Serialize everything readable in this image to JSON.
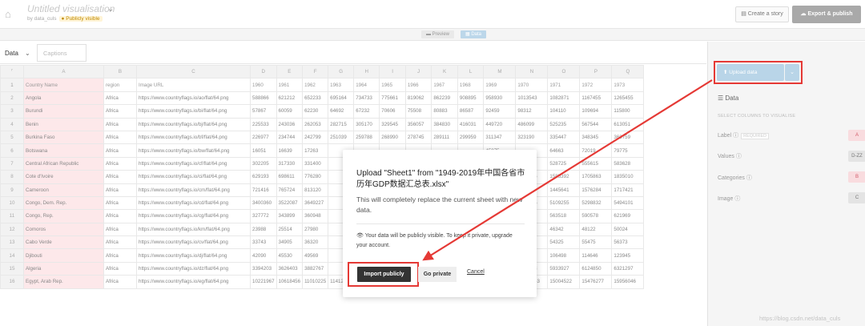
{
  "header": {
    "title": "Untitled visualisation",
    "byline": "by data_culs",
    "visibility_badge": "Publicly visible",
    "create_story": "Create a story",
    "export_publish": "Export & publish"
  },
  "view_toggle": {
    "preview": "Preview",
    "data": "Data"
  },
  "tabs": {
    "data": "Data",
    "captions": "Captions"
  },
  "sheet": {
    "columns": [
      "A",
      "B",
      "C",
      "D",
      "E",
      "F",
      "G",
      "H",
      "I",
      "J",
      "K",
      "L",
      "M",
      "N",
      "O",
      "P",
      "Q"
    ],
    "rows": [
      [
        "Country Name",
        "region",
        "Image URL",
        "1960",
        "1961",
        "1962",
        "1963",
        "1964",
        "1965",
        "1966",
        "1967",
        "1968",
        "1969",
        "1970",
        "1971",
        "1972",
        "1973"
      ],
      [
        "Angola",
        "Africa",
        "https://www.countryflags.io/ao/flat/64.png",
        "588866",
        "621212",
        "652233",
        "695164",
        "734733",
        "775661",
        "819062",
        "862239",
        "908895",
        "958930",
        "1013543",
        "1082871",
        "1167455",
        "1265455"
      ],
      [
        "Burundi",
        "Africa",
        "https://www.countryflags.io/bi/flat/64.png",
        "57867",
        "60059",
        "62230",
        "64692",
        "67232",
        "70606",
        "75508",
        "80883",
        "86587",
        "92459",
        "98312",
        "104110",
        "109694",
        "115800"
      ],
      [
        "Benin",
        "Africa",
        "https://www.countryflags.io/bj/flat/64.png",
        "225533",
        "243036",
        "262053",
        "282715",
        "305170",
        "329545",
        "356057",
        "384830",
        "416031",
        "449720",
        "486099",
        "525235",
        "567544",
        "613051"
      ],
      [
        "Burkina Faso",
        "Africa",
        "https://www.countryflags.io/bf/flat/64.png",
        "226977",
        "234744",
        "242799",
        "251039",
        "259788",
        "268990",
        "278745",
        "289111",
        "299959",
        "311347",
        "323190",
        "335447",
        "348345",
        "363759"
      ],
      [
        "Botswana",
        "Africa",
        "https://www.countryflags.io/bw/flat/64.png",
        "16051",
        "16639",
        "17263",
        "",
        "",
        "",
        "",
        "",
        "",
        "45875",
        "",
        "64663",
        "72019",
        "79775"
      ],
      [
        "Central African Republic",
        "Africa",
        "https://www.countryflags.io/cf/flat/64.png",
        "302205",
        "317330",
        "331400",
        "",
        "",
        "",
        "",
        "",
        "",
        "477093",
        "502249",
        "528725",
        "555615",
        "583628"
      ],
      [
        "Cote d'Ivoire",
        "Africa",
        "https://www.countryflags.io/ci/flat/64.png",
        "629193",
        "698611",
        "776280",
        "",
        "",
        "",
        "",
        "",
        "",
        "1377863",
        "1476416",
        "1585392",
        "1705863",
        "1835010"
      ],
      [
        "Cameroon",
        "Africa",
        "https://www.countryflags.io/cm/flat/64.png",
        "721416",
        "765724",
        "813120",
        "",
        "",
        "",
        "",
        "",
        "",
        "1245992",
        "1325110",
        "1445641",
        "1576284",
        "1717421"
      ],
      [
        "Congo, Dem. Rep.",
        "Africa",
        "https://www.countryflags.io/cd/flat/64.png",
        "3400360",
        "3522087",
        "3649227",
        "",
        "",
        "",
        "",
        "",
        "",
        "4742135",
        "4924045",
        "5109255",
        "5298832",
        "5494101"
      ],
      [
        "Congo, Rep.",
        "Africa",
        "https://www.countryflags.io/cg/flat/64.png",
        "327772",
        "343899",
        "360948",
        "",
        "",
        "",
        "",
        "",
        "",
        "504128",
        "534037",
        "563518",
        "590578",
        "621969"
      ],
      [
        "Comoros",
        "Africa",
        "https://www.countryflags.io/km/flat/64.png",
        "23988",
        "25514",
        "27980",
        "",
        "",
        "",
        "",
        "",
        "",
        "42891",
        "44607",
        "46342",
        "48122",
        "50024"
      ],
      [
        "Cabo Verde",
        "Africa",
        "https://www.countryflags.io/cv/flat/64.png",
        "33743",
        "34905",
        "36320",
        "",
        "",
        "",
        "",
        "",
        "",
        "51008",
        "52848",
        "54325",
        "55475",
        "56373"
      ],
      [
        "Djibouti",
        "Africa",
        "https://www.countryflags.io/dj/flat/64.png",
        "42090",
        "45530",
        "49569",
        "",
        "",
        "",
        "",
        "",
        "",
        "90927",
        "98633",
        "106498",
        "114646",
        "123945"
      ],
      [
        "Algeria",
        "Africa",
        "https://www.countryflags.io/dz/flat/64.png",
        "3394203",
        "3626403",
        "3882767",
        "",
        "",
        "",
        "",
        "",
        "",
        "5563573",
        "5747263",
        "5933927",
        "6124850",
        "6321297"
      ],
      [
        "Egypt, Arab Rep.",
        "Africa",
        "https://www.countryflags.io/eg/flat/64.png",
        "10221967",
        "10618456",
        "11010225",
        "11412953",
        "11827265",
        "12253435",
        "12692359",
        "13143419",
        "13603903",
        "14068932",
        "14536143",
        "15004522",
        "15476277",
        "15956046"
      ]
    ]
  },
  "sidebar": {
    "upload_label": "Upload data",
    "section_title": "Data",
    "select_header": "SELECT COLUMNS TO VISUALISE",
    "bindings": [
      {
        "label": "Label",
        "required": "REQUIRED",
        "column": "A"
      },
      {
        "label": "Values",
        "required": "",
        "column": "D-ZZ"
      },
      {
        "label": "Categories",
        "required": "",
        "column": "B"
      },
      {
        "label": "Image",
        "required": "",
        "column": "C"
      }
    ]
  },
  "modal": {
    "title": "Upload \"Sheet1\" from \"1949-2019年中国各省市历年GDP数据汇总表.xlsx\"",
    "body": "This will completely replace the current sheet with new data.",
    "note": "Your data will be publicly visible. To keep it private, upgrade your account.",
    "import_button": "Import publicly",
    "private_button": "Go private",
    "cancel_link": "Cancel"
  },
  "watermark": "https://blog.csdn.net/data_culs",
  "colors": {
    "annotation_red": "#e53935",
    "accent_blue": "#b9d5e8"
  }
}
